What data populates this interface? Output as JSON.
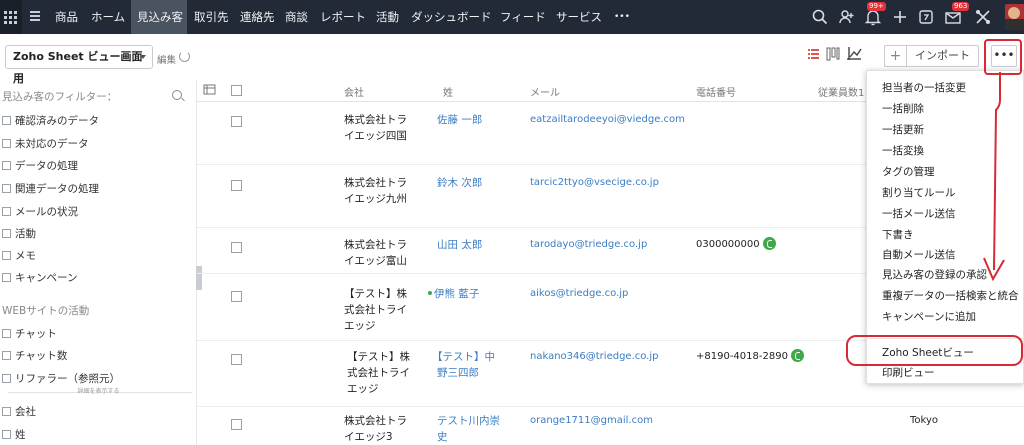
{
  "nav": {
    "items": [
      {
        "label": "商品",
        "active": false
      },
      {
        "label": "ホーム",
        "active": false
      },
      {
        "label": "見込み客",
        "active": true
      },
      {
        "label": "取引先",
        "active": false
      },
      {
        "label": "連絡先",
        "active": false
      },
      {
        "label": "商談",
        "active": false
      },
      {
        "label": "レポート",
        "active": false
      },
      {
        "label": "活動",
        "active": false
      },
      {
        "label": "ダッシュボード",
        "active": false
      },
      {
        "label": "フィード",
        "active": false
      },
      {
        "label": "サービス",
        "active": false
      },
      {
        "label": "•••",
        "active": false
      }
    ],
    "notifications_badge": "99+",
    "mail_badge": "963",
    "right_icons": [
      "search-icon",
      "people-icon",
      "bell-icon",
      "plus-icon",
      "calendar-icon",
      "mail-icon",
      "tools-icon",
      "avatar"
    ]
  },
  "toolbar": {
    "view_name": "Zoho Sheet ビュー画面用",
    "edit_label": "編集",
    "plus_label": "+",
    "import_label": "インポート",
    "more_label": "•••"
  },
  "sidebar": {
    "filter_title": "見込み客のフィルター：",
    "filters": [
      "確認済みのデータ",
      "未対応のデータ",
      "データの処理",
      "関連データの処理",
      "メールの状況",
      "活動",
      "メモ",
      "キャンペーン"
    ],
    "web_title": "WEBサイトの活動",
    "web_filters": [
      "チャット",
      "チャット数",
      "リファラー（参照元）"
    ],
    "show_more": "詳細を表示する",
    "field_filters": [
      "会社",
      "姓"
    ]
  },
  "table": {
    "headers": {
      "company": "会社",
      "last_name": "姓",
      "email": "メール",
      "phone": "電話番号",
      "employees": "従業員数1"
    },
    "rows": [
      {
        "company": [
          "株式会社トラ",
          "イエッジ四国"
        ],
        "name": [
          "佐藤 一郎"
        ],
        "email": "eatzailtarodeeyoi@viedge.com",
        "phone": "",
        "city": "",
        "active_dot": false
      },
      {
        "company": [
          "株式会社トラ",
          "イエッジ九州"
        ],
        "name": [
          "鈴木 次郎"
        ],
        "email": "tarcic2ttyo@vsecige.co.jp",
        "phone": "",
        "city": "",
        "active_dot": false
      },
      {
        "company": [
          "株式会社トラ",
          "イエッジ富山"
        ],
        "name": [
          "山田 太郎"
        ],
        "email": "tarodayo@triedge.co.jp",
        "phone": "0300000000",
        "city": "",
        "active_dot": false
      },
      {
        "company": [
          "【テスト】株",
          "式会社トライ",
          "エッジ"
        ],
        "name": [
          "伊熊 藍子"
        ],
        "email": "aikos@triedge.co.jp",
        "phone": "",
        "city": "",
        "active_dot": true
      },
      {
        "company": [
          "【テスト】株",
          "式会社トライ",
          "エッジ"
        ],
        "name": [
          "【テスト】中",
          "野三四郎"
        ],
        "email": "nakano346@triedge.co.jp",
        "phone": "+8190-4018-2890",
        "city": "",
        "active_dot": false
      },
      {
        "company": [
          "株式会社トラ",
          "イエッジ3"
        ],
        "name": [
          "テスト川内崇",
          "史"
        ],
        "email": "orange1711@gmail.com",
        "phone": "",
        "city": "Tokyo",
        "active_dot": false
      }
    ]
  },
  "dropdown": {
    "items": [
      "担当者の一括変更",
      "一括削除",
      "一括更新",
      "一括変換",
      "タグの管理",
      "割り当てルール",
      "一括メール送信",
      "下書き",
      "自動メール送信",
      "見込み客の登録の承認",
      "重複データの一括検索と統合",
      "キャンペーンに追加"
    ],
    "bottom_items": [
      "Zoho Sheetビュー",
      "印刷ビュー"
    ]
  },
  "annotation_color": "#d62a35"
}
